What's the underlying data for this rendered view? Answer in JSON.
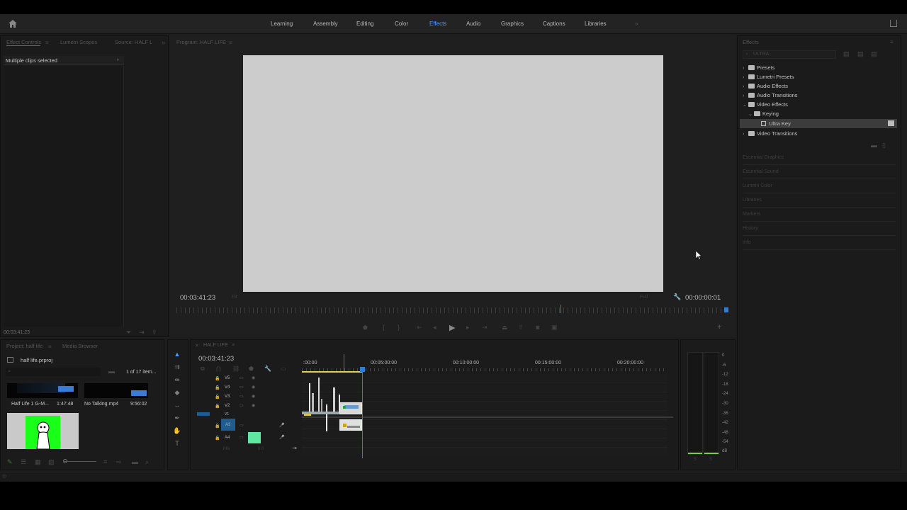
{
  "header": {
    "home_icon": "home-icon",
    "tabs": [
      "Learning",
      "Assembly",
      "Editing",
      "Color",
      "Effects",
      "Audio",
      "Graphics",
      "Captions",
      "Libraries"
    ],
    "active_tab": "Effects",
    "more": "»",
    "share_icon": "share-icon"
  },
  "source_panel": {
    "tabs": [
      "Effect Controls",
      "Lumetri Scopes",
      "Source: HALF L"
    ],
    "message": "Multiple clips selected",
    "timecode": "00:03:41:23"
  },
  "program": {
    "title": "Program: HALF LIFE",
    "timecode_left": "00:03:41:23",
    "fit": "Fit",
    "quality": "Full",
    "timecode_right": "00:00:00:01",
    "controls": [
      "marker-icon",
      "mark-in-icon",
      "mark-out-icon",
      "go-to-in-icon",
      "step-back-icon",
      "play-icon",
      "step-forward-icon",
      "go-to-out-icon",
      "lift-icon",
      "extract-icon",
      "export-frame-icon",
      "comparison-icon"
    ],
    "add": "+"
  },
  "effects": {
    "title": "Effects",
    "search_value": "ULTRA",
    "tree": [
      {
        "label": "Presets",
        "expanded": false
      },
      {
        "label": "Lumetri Presets",
        "expanded": false
      },
      {
        "label": "Audio Effects",
        "expanded": false
      },
      {
        "label": "Audio Transitions",
        "expanded": false
      },
      {
        "label": "Video Effects",
        "expanded": true
      },
      {
        "label": "Keying",
        "expanded": true
      },
      {
        "label": "Ultra Key",
        "selected": true
      },
      {
        "label": "Video Transitions",
        "expanded": false
      }
    ],
    "sections": [
      "Essential Graphics",
      "Essential Sound",
      "Lumetri Color",
      "Libraries",
      "Markers",
      "History",
      "Info"
    ]
  },
  "project": {
    "tabs": [
      "Project: half life",
      "Media Browser"
    ],
    "file": "half life.prproj",
    "count": "1 of 17 item...",
    "items": [
      {
        "name": "Half Life 1 G-M...",
        "duration": "1:47:48"
      },
      {
        "name": "No Talking.mp4",
        "duration": "9:56:02"
      }
    ]
  },
  "timeline": {
    "title": "HALF LIFE",
    "timecode": "00:03:41:23",
    "ruler": [
      ":00:00",
      "00:05:00:00",
      "00:10:00:00",
      "00:15:00:00",
      "00:20:00:00"
    ],
    "video_tracks": [
      "V5",
      "V4",
      "V3",
      "V2",
      "V1"
    ],
    "audio_tracks": [
      "A3",
      "A4"
    ],
    "mix": "Mix",
    "mix_value": "0.0",
    "meter_scale": [
      "0",
      "-6",
      "-12",
      "-18",
      "-24",
      "-30",
      "-36",
      "-42",
      "-48",
      "-54",
      "dB"
    ],
    "meter_solo": [
      "S",
      "S"
    ]
  },
  "colors": {
    "accent": "#4a9eff",
    "green_screen": "#1aff1a",
    "monitor_bg": "#cccccc",
    "playhead": "#2d7dd2",
    "audio_track_active": "#5ee8a0"
  }
}
